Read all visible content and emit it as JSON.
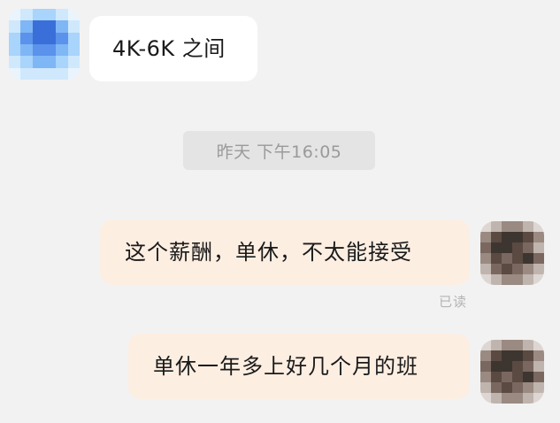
{
  "messages": [
    {
      "side": "left",
      "text": "4K-6K 之间"
    },
    {
      "side": "right",
      "text": "这个薪酬，单休，不太能接受"
    },
    {
      "side": "right",
      "text": "单休一年多上好几个月的班"
    }
  ],
  "timestamp": "昨天 下午16:05",
  "read_status": "已读",
  "avatars": {
    "left": {
      "icon": "pixelated-avatar-icon",
      "colors": [
        "#3a6fd9",
        "#5a92ec",
        "#7fb6f5",
        "#a9d4fb",
        "#cfe8fc",
        "#e9f4fd"
      ]
    },
    "right": {
      "icon": "pixelated-avatar-icon",
      "colors": [
        "#3d3530",
        "#5a4a42",
        "#7a6860",
        "#9a8a82",
        "#c0b4ae",
        "#ddd6d2"
      ]
    }
  },
  "colors": {
    "background": "#f2f2f2",
    "bubble_left": "#ffffff",
    "bubble_right": "#fdeee2",
    "time_chip": "#e4e4e4"
  }
}
